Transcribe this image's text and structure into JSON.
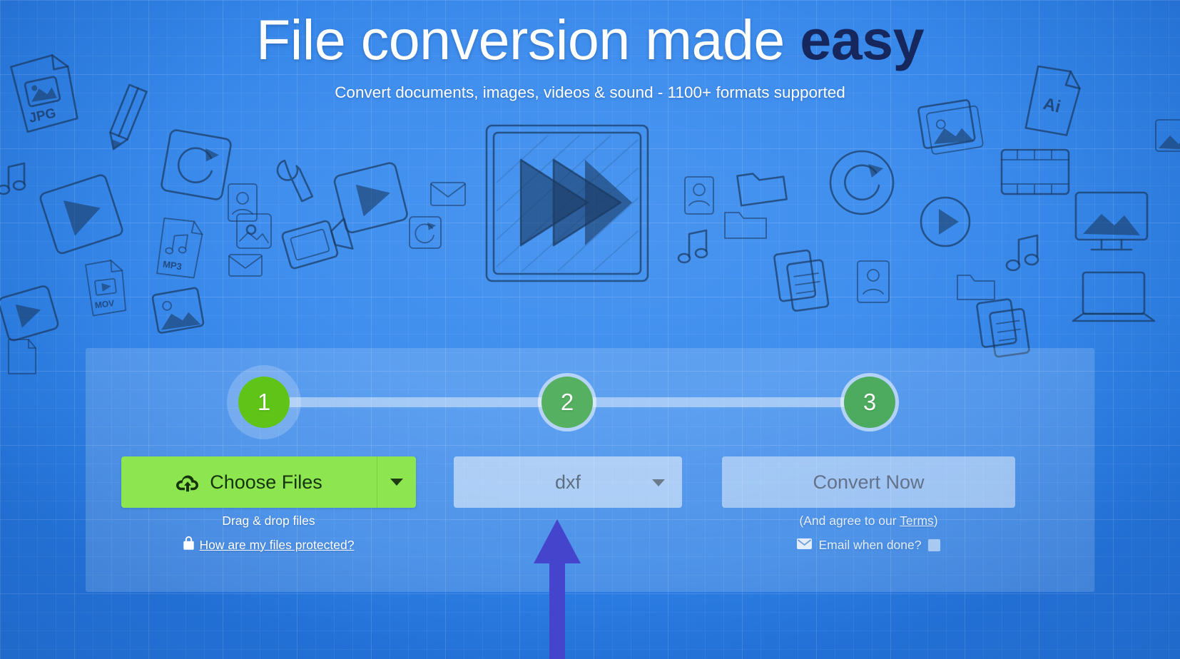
{
  "header": {
    "headline_main": "File conversion made ",
    "headline_accent": "easy",
    "subhead": "Convert documents, images, videos & sound - 1100+ formats supported"
  },
  "steps": [
    {
      "number": "1",
      "state": "active"
    },
    {
      "number": "2",
      "state": "inactive"
    },
    {
      "number": "3",
      "state": "inactive"
    }
  ],
  "controls": {
    "choose_files_label": "Choose Files",
    "choose_files_icon": "cloud-upload-icon",
    "choose_files_caret_icon": "chevron-down-icon",
    "format_value": "dxf",
    "format_caret_icon": "chevron-down-icon",
    "convert_now_label": "Convert Now"
  },
  "notes": {
    "drag_drop": "Drag & drop files",
    "protected_link": "How are my files protected?",
    "lock_icon": "lock-icon",
    "terms_prefix": "(And agree to our ",
    "terms_link": "Terms",
    "terms_suffix": ")",
    "email_when_done": "Email when done?",
    "envelope_icon": "envelope-icon",
    "email_checked": false
  },
  "annotation": {
    "arrow_icon": "up-arrow-icon",
    "arrow_color": "#4444cc",
    "points_at": "format-select"
  },
  "colors": {
    "background_blue": "#3f8eee",
    "background_blue_dark": "#2474dc",
    "panel_overlay": "rgba(255,255,255,0.155)",
    "accent_green": "#8de64f",
    "step_active_green": "#5fc417",
    "step_inactive_green": "#4cab5f",
    "headline_accent_navy": "#15275c",
    "doodle_navy": "#1b3a63"
  },
  "doodle_labels": {
    "jpg": "JPG",
    "mp3": "MP3",
    "mov": "MOV",
    "ai": "Ai"
  }
}
